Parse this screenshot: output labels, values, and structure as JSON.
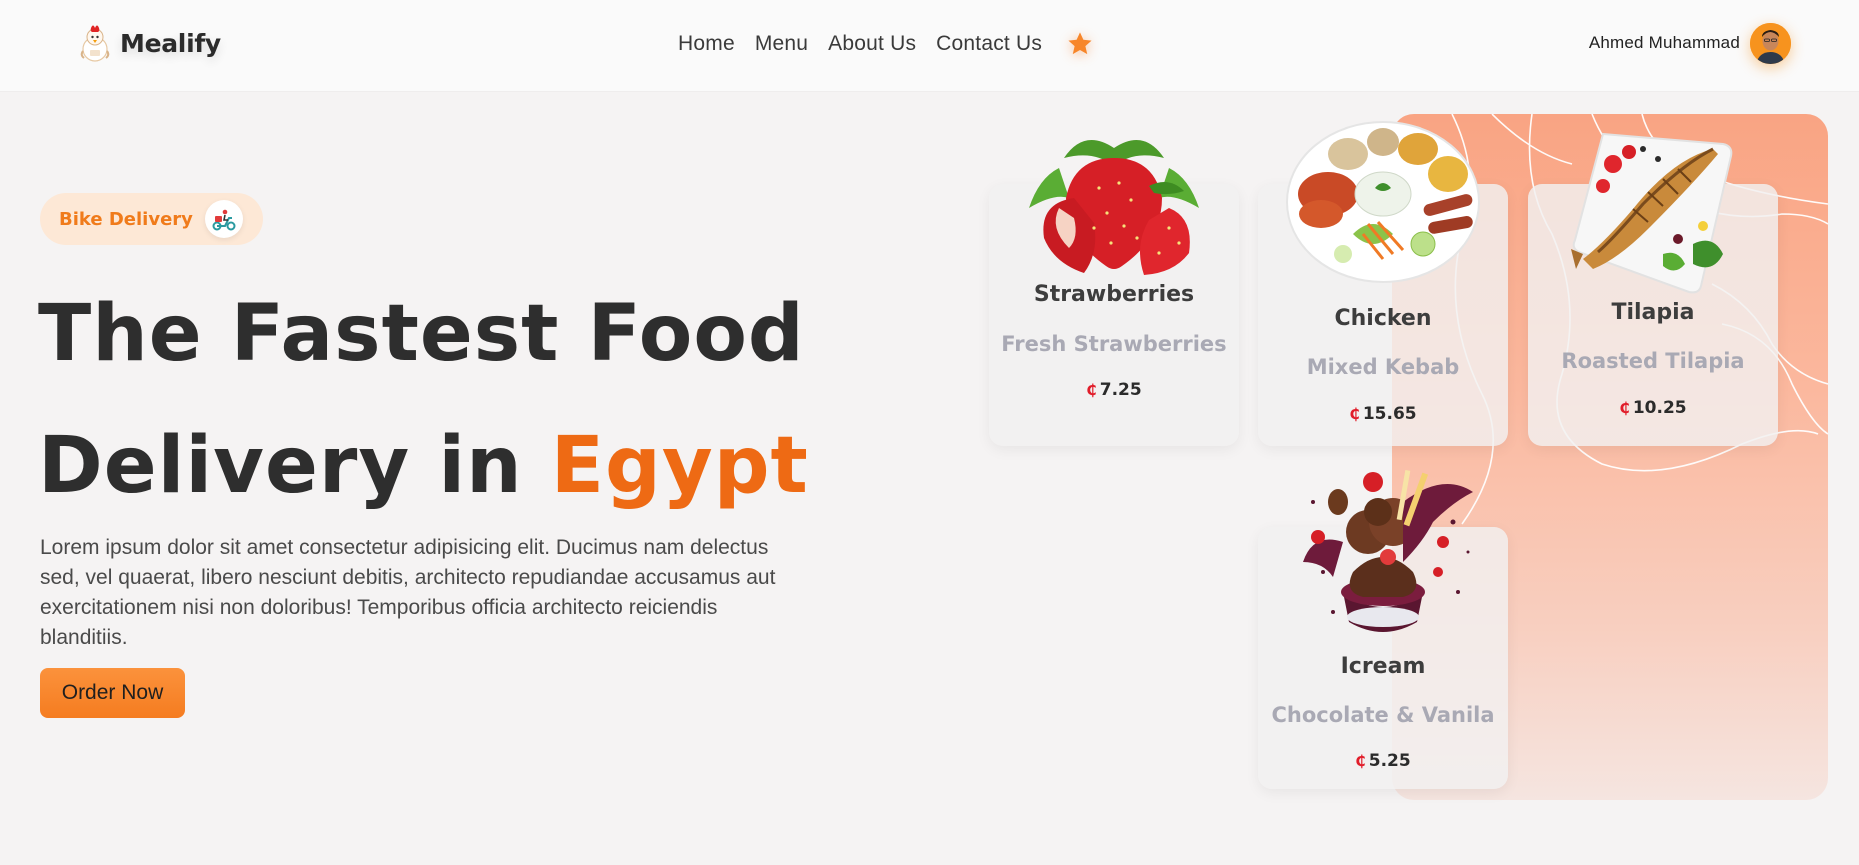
{
  "header": {
    "brand": "Mealify",
    "nav": [
      "Home",
      "Menu",
      "About Us",
      "Contact Us"
    ],
    "user_name": "Ahmed Muhammad"
  },
  "hero": {
    "badge": "Bike Delivery",
    "headline_line1": "The Fastest Food",
    "headline_line2": "Delivery in ",
    "headline_accent": "Egypt",
    "description": "Lorem ipsum dolor sit amet consectetur adipisicing elit. Ducimus nam delectus sed, vel quaerat, libero nesciunt debitis, architecto repudiandae accusamus aut exercitationem nisi non doloribus! Temporibus officia architecto reiciendis blanditiis.",
    "order_button": "Order Now"
  },
  "menu_cards": [
    {
      "name": "Strawberries",
      "desc": "Fresh Strawberries",
      "currency": "₵",
      "price": "7.25"
    },
    {
      "name": "Chicken",
      "desc": "Mixed Kebab",
      "currency": "₵",
      "price": "15.65"
    },
    {
      "name": "Tilapia",
      "desc": "Roasted Tilapia",
      "currency": "₵",
      "price": "10.25"
    },
    {
      "name": "Icream",
      "desc": "Chocolate & Vanila",
      "currency": "₵",
      "price": "5.25"
    }
  ],
  "colors": {
    "accent": "#ee6a14",
    "button": "#f57c20",
    "badge_bg": "#fde8d6",
    "showcase_bg": "#f9a483"
  },
  "icons": {
    "logo": "chef-chicken-icon",
    "favorite": "star-icon",
    "badge": "scooter-icon"
  }
}
